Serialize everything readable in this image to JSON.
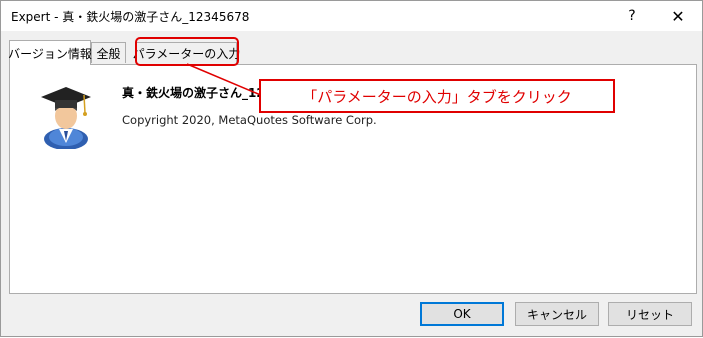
{
  "window": {
    "title": "Expert - 真・鉄火場の激子さん_12345678",
    "help_glyph": "?",
    "close_glyph": "✕"
  },
  "tabs": [
    {
      "label": "バージョン情報",
      "active": true
    },
    {
      "label": "全般",
      "active": false
    },
    {
      "label": "パラメーターの入力",
      "active": false
    }
  ],
  "info": {
    "expert_name": "真・鉄火場の激子さん_12345678",
    "copyright": "Copyright 2020, MetaQuotes Software Corp.",
    "icon": "expert-graduate-icon"
  },
  "annotation": {
    "callout_text": "「パラメーターの入力」タブをクリック",
    "color": "#e00000"
  },
  "buttons": {
    "ok": "OK",
    "cancel": "キャンセル",
    "reset": "リセット"
  }
}
